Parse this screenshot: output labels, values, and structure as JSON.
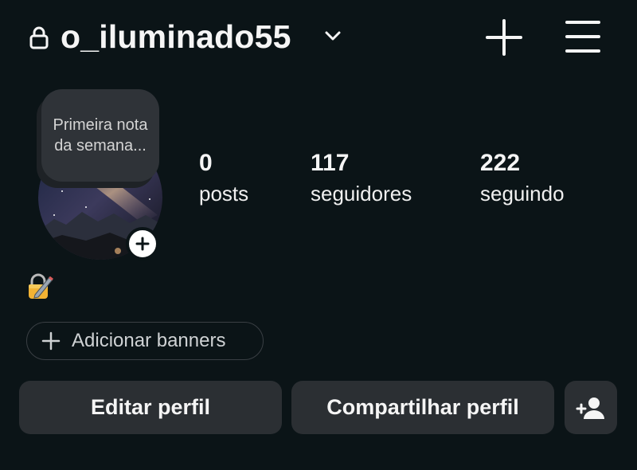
{
  "header": {
    "username": "o_iluminado55",
    "lock_icon": "lock-icon",
    "dropdown_icon": "chevron-down-icon",
    "create_icon": "plus-icon",
    "menu_icon": "hamburger-menu-icon"
  },
  "profile": {
    "note_text": "Primeira nota da semana...",
    "avatar_description": "avatar",
    "add_story_icon": "plus-icon"
  },
  "stats": [
    {
      "value": "0",
      "label": "posts"
    },
    {
      "value": "117",
      "label": "seguidores"
    },
    {
      "value": "222",
      "label": "seguindo"
    }
  ],
  "bio": {
    "emoji": "locked-with-pen-emoji"
  },
  "banners": {
    "label": "Adicionar banners"
  },
  "actions": {
    "edit_label": "Editar perfil",
    "share_label": "Compartilhar perfil",
    "discover_icon": "add-person-icon"
  },
  "colors": {
    "background": "#0b1417",
    "button_bg": "#2b2f33",
    "note_bg": "#2f3338",
    "text": "#f5f5f5"
  }
}
